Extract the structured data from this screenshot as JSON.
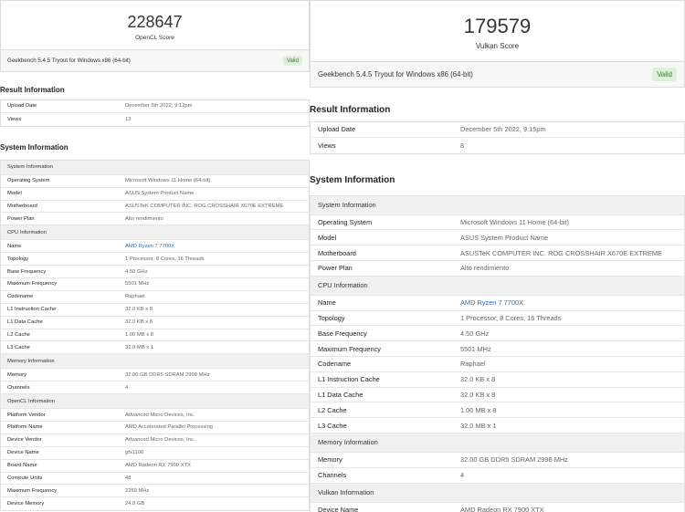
{
  "left": {
    "score": "228647",
    "score_label": "OpenCL Score",
    "platform": "Geekbench 5.4.5 Tryout for Windows x86 (64-bit)",
    "valid": "Valid",
    "result_title": "Result Information",
    "result": [
      {
        "k": "Upload Date",
        "v": "December 5th 2022, 9:12pm"
      },
      {
        "k": "Views",
        "v": "13"
      }
    ],
    "system_title": "System Information",
    "groups": [
      {
        "title": "System Information",
        "rows": [
          {
            "k": "Operating System",
            "v": "Microsoft Windows 11 Home (64-bit)"
          },
          {
            "k": "Model",
            "v": "ASUS System Product Name"
          },
          {
            "k": "Motherboard",
            "v": "ASUSTeK COMPUTER INC. ROG CROSSHAIR X670E EXTREME"
          },
          {
            "k": "Power Plan",
            "v": "Alto rendimiento"
          }
        ]
      },
      {
        "title": "CPU Information",
        "rows": [
          {
            "k": "Name",
            "v": "AMD Ryzen 7 7700X",
            "link": true
          },
          {
            "k": "Topology",
            "v": "1 Processor, 8 Cores, 16 Threads"
          },
          {
            "k": "Base Frequency",
            "v": "4.50 GHz"
          },
          {
            "k": "Maximum Frequency",
            "v": "5501 MHz"
          },
          {
            "k": "Codename",
            "v": "Raphael"
          },
          {
            "k": "L1 Instruction Cache",
            "v": "32.0 KB x 8"
          },
          {
            "k": "L1 Data Cache",
            "v": "32.0 KB x 8"
          },
          {
            "k": "L2 Cache",
            "v": "1.00 MB x 8"
          },
          {
            "k": "L3 Cache",
            "v": "32.0 MB x 1"
          }
        ]
      },
      {
        "title": "Memory Information",
        "rows": [
          {
            "k": "Memory",
            "v": "32.00 GB DDR5 SDRAM 2998 MHz"
          },
          {
            "k": "Channels",
            "v": "4"
          }
        ]
      },
      {
        "title": "OpenCL Information",
        "rows": [
          {
            "k": "Platform Vendor",
            "v": "Advanced Micro Devices, Inc."
          },
          {
            "k": "Platform Name",
            "v": "AMD Accelerated Parallel Processing"
          },
          {
            "k": "Device Vendor",
            "v": "Advanced Micro Devices, Inc."
          },
          {
            "k": "Device Name",
            "v": "gfx1100"
          },
          {
            "k": "Board Name",
            "v": "AMD Radeon RX 7900 XTX"
          },
          {
            "k": "Compute Units",
            "v": "48"
          },
          {
            "k": "Maximum Frequency",
            "v": "2269 MHz"
          },
          {
            "k": "Device Memory",
            "v": "24.0 GB"
          }
        ]
      }
    ]
  },
  "right": {
    "score": "179579",
    "score_label": "Vulkan Score",
    "platform": "Geekbench 5.4.5 Tryout for Windows x86 (64-bit)",
    "valid": "Valid",
    "result_title": "Result Information",
    "result": [
      {
        "k": "Upload Date",
        "v": "December 5th 2022, 9:15pm"
      },
      {
        "k": "Views",
        "v": "8"
      }
    ],
    "system_title": "System Information",
    "groups": [
      {
        "title": "System Information",
        "rows": [
          {
            "k": "Operating System",
            "v": "Microsoft Windows 11 Home (64-bit)"
          },
          {
            "k": "Model",
            "v": "ASUS System Product Name"
          },
          {
            "k": "Motherboard",
            "v": "ASUSTeK COMPUTER INC. ROG CROSSHAIR X670E EXTREME"
          },
          {
            "k": "Power Plan",
            "v": "Alto rendimiento"
          }
        ]
      },
      {
        "title": "CPU Information",
        "rows": [
          {
            "k": "Name",
            "v": "AMD Ryzen 7 7700X",
            "link": true
          },
          {
            "k": "Topology",
            "v": "1 Processor, 8 Cores, 16 Threads"
          },
          {
            "k": "Base Frequency",
            "v": "4.50 GHz"
          },
          {
            "k": "Maximum Frequency",
            "v": "5501 MHz"
          },
          {
            "k": "Codename",
            "v": "Raphael"
          },
          {
            "k": "L1 Instruction Cache",
            "v": "32.0 KB x 8"
          },
          {
            "k": "L1 Data Cache",
            "v": "32.0 KB x 8"
          },
          {
            "k": "L2 Cache",
            "v": "1.00 MB x 8"
          },
          {
            "k": "L3 Cache",
            "v": "32.0 MB x 1"
          }
        ]
      },
      {
        "title": "Memory Information",
        "rows": [
          {
            "k": "Memory",
            "v": "32.00 GB DDR5 SDRAM 2998 MHz"
          },
          {
            "k": "Channels",
            "v": "4"
          }
        ]
      },
      {
        "title": "Vulkan Information",
        "rows": [
          {
            "k": "Device Name",
            "v": "AMD Radeon RX 7900 XTX"
          }
        ]
      }
    ]
  }
}
